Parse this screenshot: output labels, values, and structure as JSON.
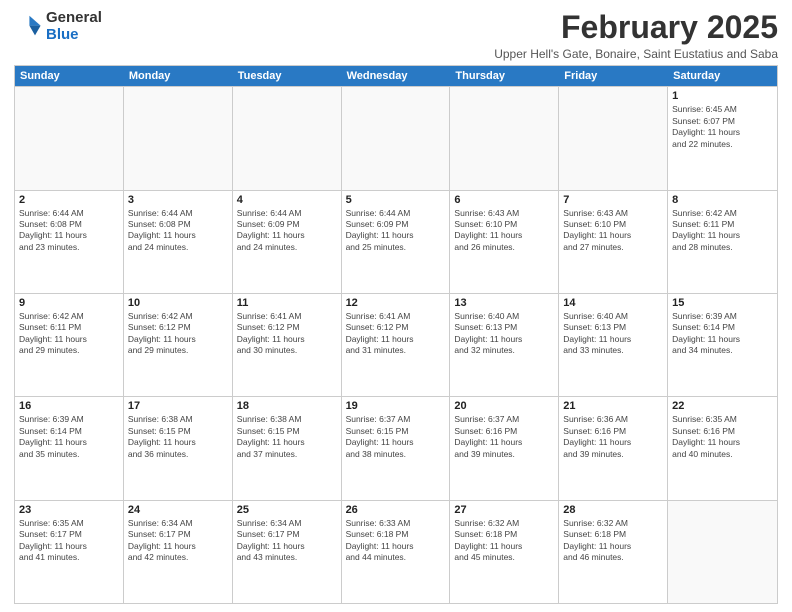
{
  "logo": {
    "general": "General",
    "blue": "Blue"
  },
  "title": "February 2025",
  "subtitle": "Upper Hell's Gate, Bonaire, Saint Eustatius and Saba",
  "dayHeaders": [
    "Sunday",
    "Monday",
    "Tuesday",
    "Wednesday",
    "Thursday",
    "Friday",
    "Saturday"
  ],
  "weeks": [
    [
      {
        "day": "",
        "info": ""
      },
      {
        "day": "",
        "info": ""
      },
      {
        "day": "",
        "info": ""
      },
      {
        "day": "",
        "info": ""
      },
      {
        "day": "",
        "info": ""
      },
      {
        "day": "",
        "info": ""
      },
      {
        "day": "1",
        "info": "Sunrise: 6:45 AM\nSunset: 6:07 PM\nDaylight: 11 hours\nand 22 minutes."
      }
    ],
    [
      {
        "day": "2",
        "info": "Sunrise: 6:44 AM\nSunset: 6:08 PM\nDaylight: 11 hours\nand 23 minutes."
      },
      {
        "day": "3",
        "info": "Sunrise: 6:44 AM\nSunset: 6:08 PM\nDaylight: 11 hours\nand 24 minutes."
      },
      {
        "day": "4",
        "info": "Sunrise: 6:44 AM\nSunset: 6:09 PM\nDaylight: 11 hours\nand 24 minutes."
      },
      {
        "day": "5",
        "info": "Sunrise: 6:44 AM\nSunset: 6:09 PM\nDaylight: 11 hours\nand 25 minutes."
      },
      {
        "day": "6",
        "info": "Sunrise: 6:43 AM\nSunset: 6:10 PM\nDaylight: 11 hours\nand 26 minutes."
      },
      {
        "day": "7",
        "info": "Sunrise: 6:43 AM\nSunset: 6:10 PM\nDaylight: 11 hours\nand 27 minutes."
      },
      {
        "day": "8",
        "info": "Sunrise: 6:42 AM\nSunset: 6:11 PM\nDaylight: 11 hours\nand 28 minutes."
      }
    ],
    [
      {
        "day": "9",
        "info": "Sunrise: 6:42 AM\nSunset: 6:11 PM\nDaylight: 11 hours\nand 29 minutes."
      },
      {
        "day": "10",
        "info": "Sunrise: 6:42 AM\nSunset: 6:12 PM\nDaylight: 11 hours\nand 29 minutes."
      },
      {
        "day": "11",
        "info": "Sunrise: 6:41 AM\nSunset: 6:12 PM\nDaylight: 11 hours\nand 30 minutes."
      },
      {
        "day": "12",
        "info": "Sunrise: 6:41 AM\nSunset: 6:12 PM\nDaylight: 11 hours\nand 31 minutes."
      },
      {
        "day": "13",
        "info": "Sunrise: 6:40 AM\nSunset: 6:13 PM\nDaylight: 11 hours\nand 32 minutes."
      },
      {
        "day": "14",
        "info": "Sunrise: 6:40 AM\nSunset: 6:13 PM\nDaylight: 11 hours\nand 33 minutes."
      },
      {
        "day": "15",
        "info": "Sunrise: 6:39 AM\nSunset: 6:14 PM\nDaylight: 11 hours\nand 34 minutes."
      }
    ],
    [
      {
        "day": "16",
        "info": "Sunrise: 6:39 AM\nSunset: 6:14 PM\nDaylight: 11 hours\nand 35 minutes."
      },
      {
        "day": "17",
        "info": "Sunrise: 6:38 AM\nSunset: 6:15 PM\nDaylight: 11 hours\nand 36 minutes."
      },
      {
        "day": "18",
        "info": "Sunrise: 6:38 AM\nSunset: 6:15 PM\nDaylight: 11 hours\nand 37 minutes."
      },
      {
        "day": "19",
        "info": "Sunrise: 6:37 AM\nSunset: 6:15 PM\nDaylight: 11 hours\nand 38 minutes."
      },
      {
        "day": "20",
        "info": "Sunrise: 6:37 AM\nSunset: 6:16 PM\nDaylight: 11 hours\nand 39 minutes."
      },
      {
        "day": "21",
        "info": "Sunrise: 6:36 AM\nSunset: 6:16 PM\nDaylight: 11 hours\nand 39 minutes."
      },
      {
        "day": "22",
        "info": "Sunrise: 6:35 AM\nSunset: 6:16 PM\nDaylight: 11 hours\nand 40 minutes."
      }
    ],
    [
      {
        "day": "23",
        "info": "Sunrise: 6:35 AM\nSunset: 6:17 PM\nDaylight: 11 hours\nand 41 minutes."
      },
      {
        "day": "24",
        "info": "Sunrise: 6:34 AM\nSunset: 6:17 PM\nDaylight: 11 hours\nand 42 minutes."
      },
      {
        "day": "25",
        "info": "Sunrise: 6:34 AM\nSunset: 6:17 PM\nDaylight: 11 hours\nand 43 minutes."
      },
      {
        "day": "26",
        "info": "Sunrise: 6:33 AM\nSunset: 6:18 PM\nDaylight: 11 hours\nand 44 minutes."
      },
      {
        "day": "27",
        "info": "Sunrise: 6:32 AM\nSunset: 6:18 PM\nDaylight: 11 hours\nand 45 minutes."
      },
      {
        "day": "28",
        "info": "Sunrise: 6:32 AM\nSunset: 6:18 PM\nDaylight: 11 hours\nand 46 minutes."
      },
      {
        "day": "",
        "info": ""
      }
    ]
  ]
}
